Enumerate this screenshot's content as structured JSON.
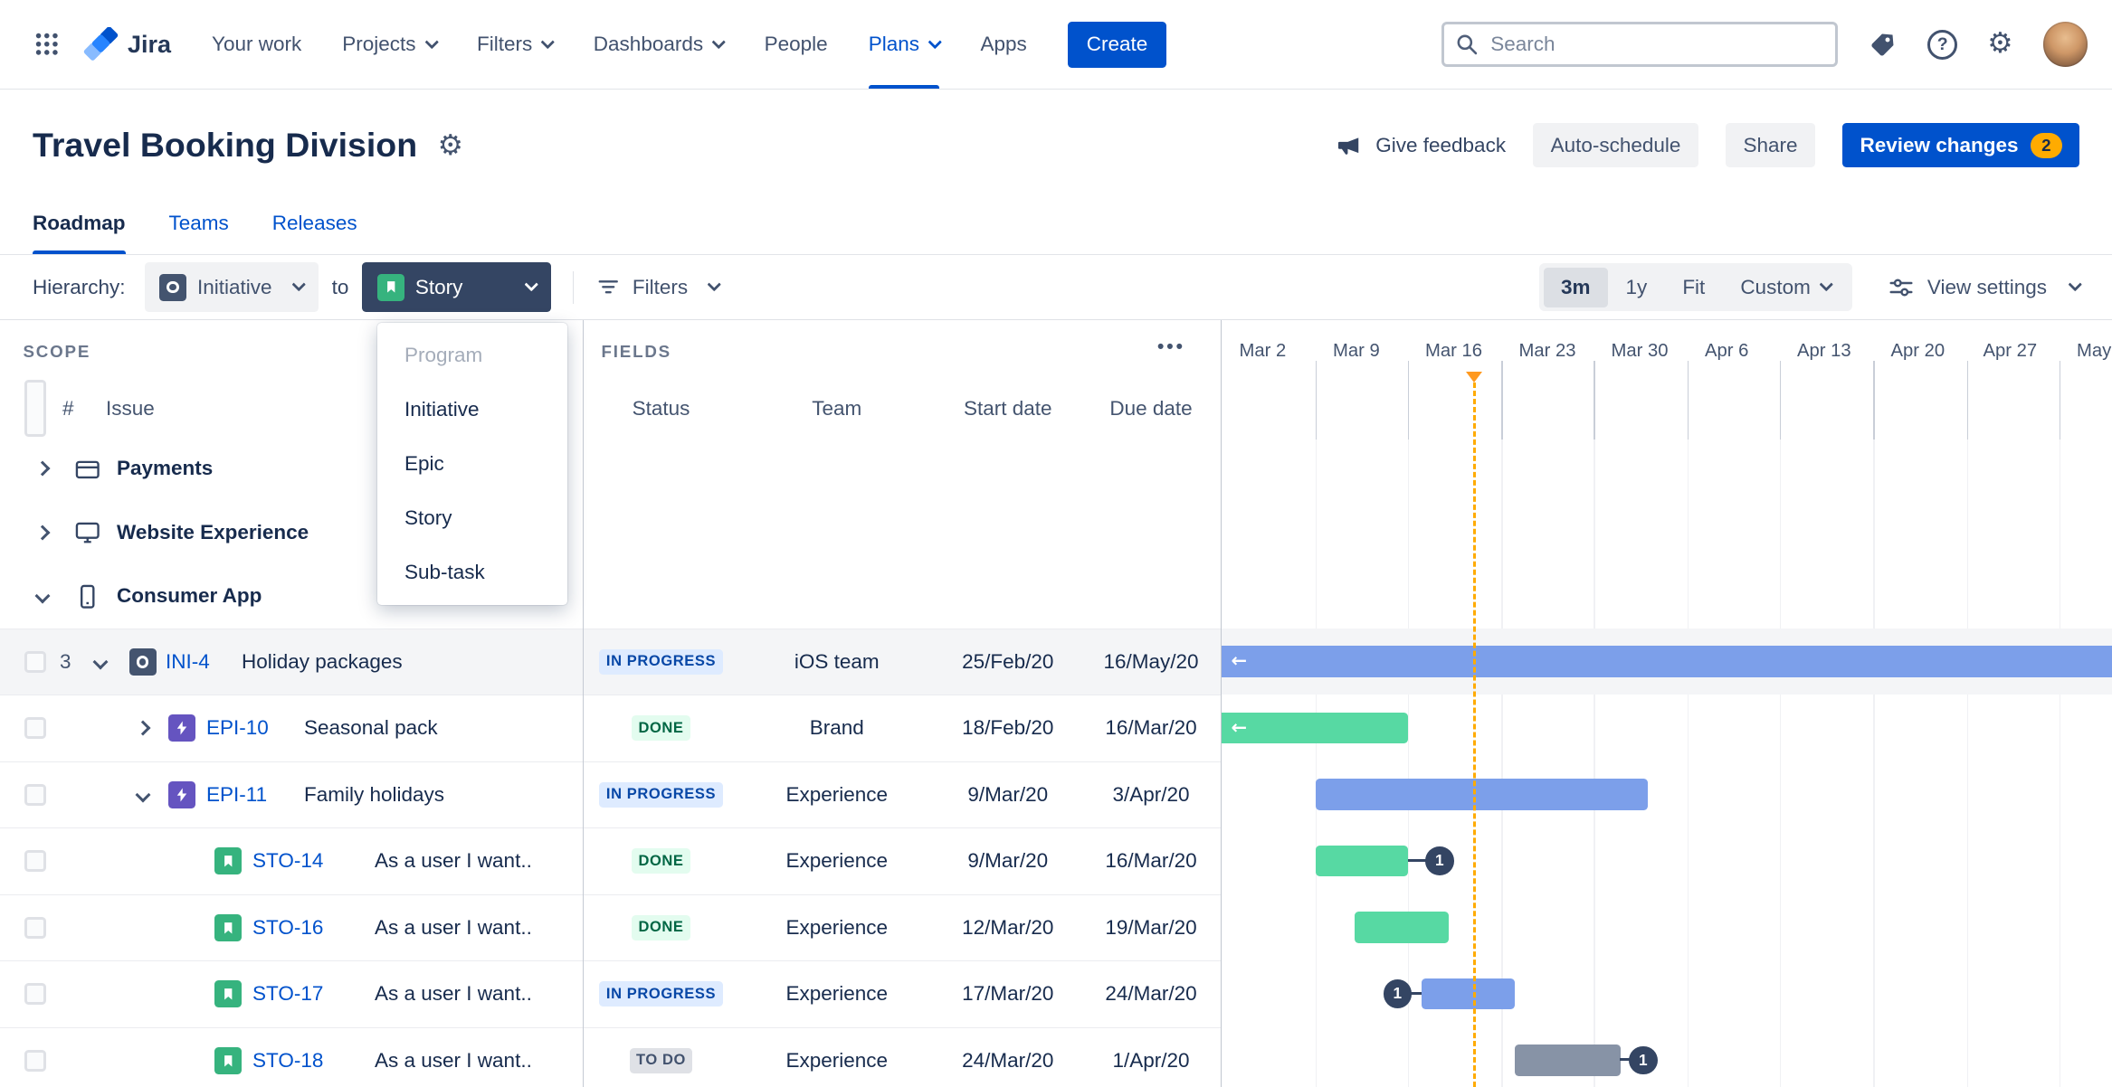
{
  "colors": {
    "brand": "#0052CC",
    "bar_blue": "#7C9FEA",
    "bar_green": "#57D9A3",
    "bar_gray": "#8793A6",
    "today_line": "#FFAB00",
    "status_inprogress_bg": "#DEEBFF",
    "status_done_bg": "#E3FCEF",
    "status_todo_bg": "#DFE1E6"
  },
  "nav": {
    "logo": "Jira",
    "items": [
      "Your work",
      "Projects",
      "Filters",
      "Dashboards",
      "People",
      "Plans",
      "Apps"
    ],
    "create": "Create",
    "search_placeholder": "Search"
  },
  "header": {
    "title": "Travel Booking Division",
    "give_feedback": "Give feedback",
    "auto_schedule": "Auto-schedule",
    "share": "Share",
    "review_changes": "Review changes",
    "review_count": "2"
  },
  "tabs": [
    "Roadmap",
    "Teams",
    "Releases"
  ],
  "toolbar": {
    "hierarchy_label": "Hierarchy:",
    "hierarchy_from": "Initiative",
    "hierarchy_to_word": "to",
    "hierarchy_to": "Story",
    "filters": "Filters",
    "zoom_options": [
      "3m",
      "1y",
      "Fit",
      "Custom"
    ],
    "zoom_selected": "3m",
    "view_settings": "View settings"
  },
  "type_menu": [
    "Program",
    "Initiative",
    "Epic",
    "Story",
    "Sub-task"
  ],
  "scope": {
    "label": "SCOPE",
    "col_hash": "#",
    "col_issue": "Issue",
    "groups": [
      "Payments",
      "Website Experience",
      "Consumer App"
    ]
  },
  "fields": {
    "label": "FIELDS",
    "columns": [
      "Status",
      "Team",
      "Start date",
      "Due date"
    ]
  },
  "timeline_dates": [
    "Mar 2",
    "Mar 9",
    "Mar 16",
    "Mar 23",
    "Mar 30",
    "Apr 6",
    "Apr 13",
    "Apr 20",
    "Apr 27",
    "May"
  ],
  "rows": [
    {
      "count": "3",
      "key": "INI-4",
      "type": "initiative",
      "summary": "Holiday packages",
      "status": "IN PROGRESS",
      "team": "iOS team",
      "start": "25/Feb/20",
      "due": "16/May/20"
    },
    {
      "key": "EPI-10",
      "type": "epic",
      "summary": "Seasonal pack",
      "status": "DONE",
      "team": "Brand",
      "start": "18/Feb/20",
      "due": "16/Mar/20"
    },
    {
      "key": "EPI-11",
      "type": "epic",
      "summary": "Family holidays",
      "status": "IN PROGRESS",
      "team": "Experience",
      "start": "9/Mar/20",
      "due": "3/Apr/20"
    },
    {
      "key": "STO-14",
      "type": "story",
      "summary": "As a user I want..",
      "status": "DONE",
      "team": "Experience",
      "start": "9/Mar/20",
      "due": "16/Mar/20",
      "badge": "1"
    },
    {
      "key": "STO-16",
      "type": "story",
      "summary": "As a user I want..",
      "status": "DONE",
      "team": "Experience",
      "start": "12/Mar/20",
      "due": "19/Mar/20"
    },
    {
      "key": "STO-17",
      "type": "story",
      "summary": "As a user I want..",
      "status": "IN PROGRESS",
      "team": "Experience",
      "start": "17/Mar/20",
      "due": "24/Mar/20",
      "badge": "1"
    },
    {
      "key": "STO-18",
      "type": "story",
      "summary": "As a user I want..",
      "status": "TO DO",
      "team": "Experience",
      "start": "24/Mar/20",
      "due": "1/Apr/20",
      "badge": "1"
    }
  ]
}
